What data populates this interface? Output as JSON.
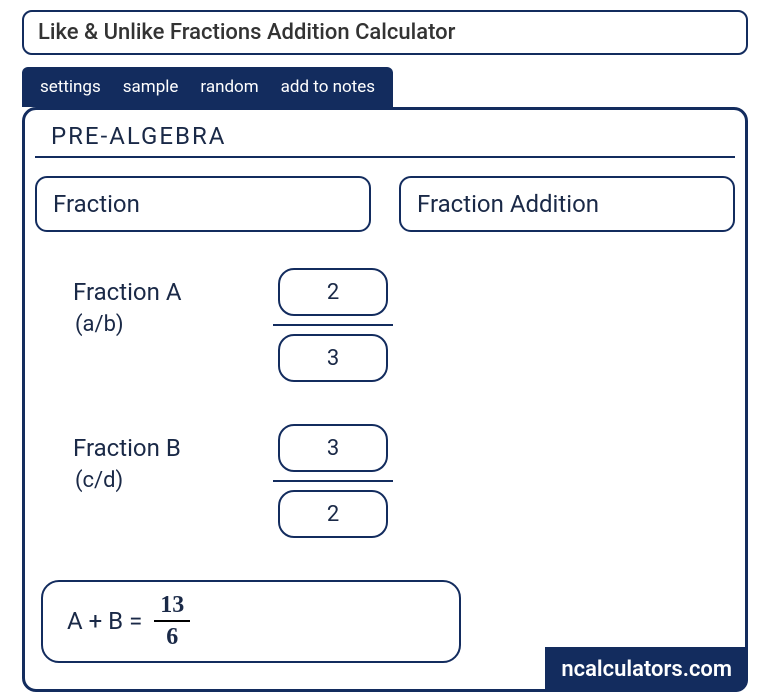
{
  "header": {
    "title": "Like & Unlike Fractions Addition Calculator"
  },
  "tabs": {
    "items": [
      "settings",
      "sample",
      "random",
      "add to notes"
    ]
  },
  "panel": {
    "section_title": "PRE-ALGEBRA",
    "select_type": "Fraction",
    "select_operation": "Fraction Addition",
    "fractionA": {
      "label": "Fraction A",
      "sublabel": "(a/b)",
      "numerator": "2",
      "denominator": "3"
    },
    "fractionB": {
      "label": "Fraction B",
      "sublabel": "(c/d)",
      "numerator": "3",
      "denominator": "2"
    },
    "result": {
      "label": "A + B  =",
      "numerator": "13",
      "denominator": "6"
    }
  },
  "brand": "ncalculators.com"
}
